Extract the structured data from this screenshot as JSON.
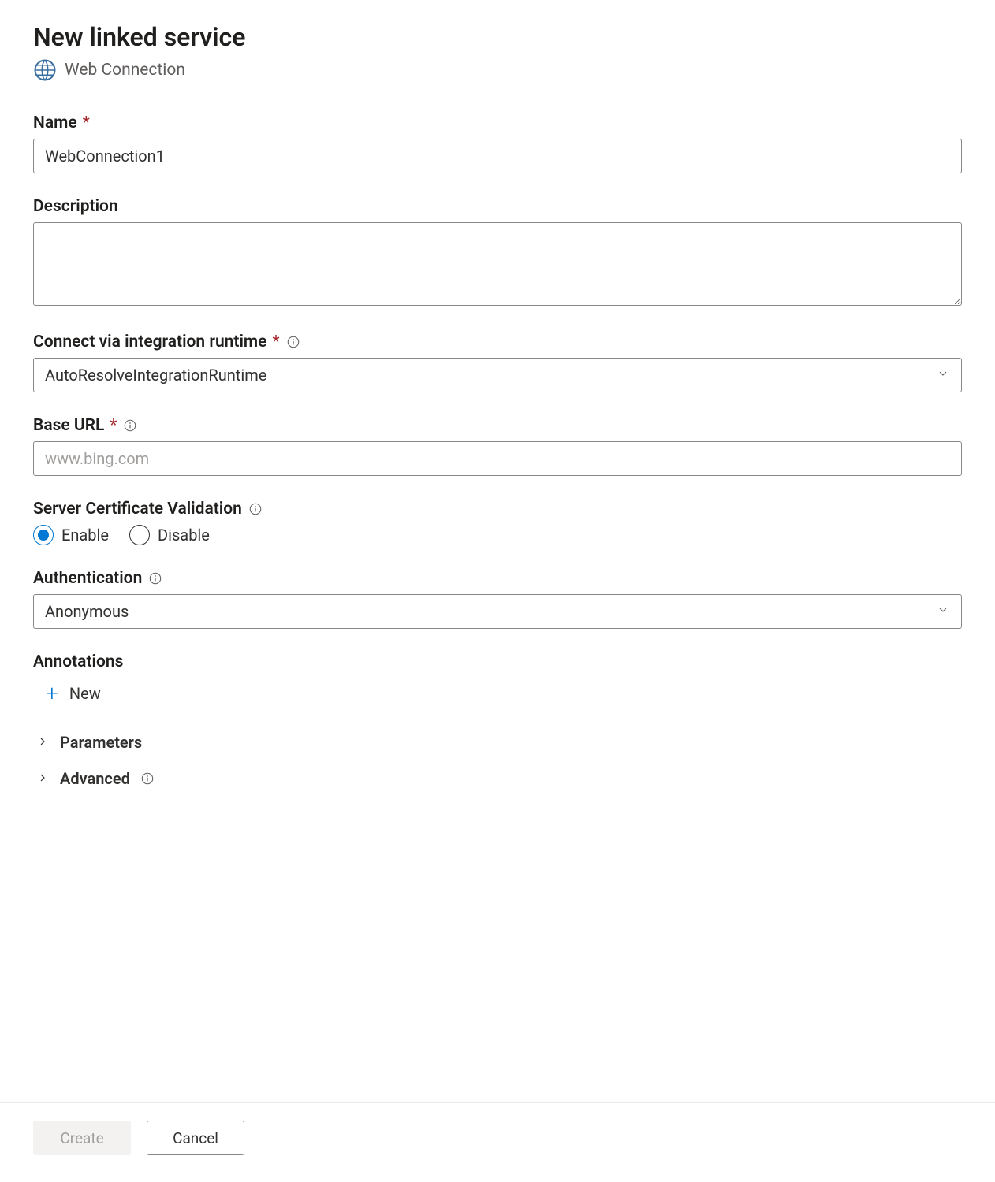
{
  "header": {
    "title": "New linked service",
    "subtitle": "Web Connection"
  },
  "form": {
    "name": {
      "label": "Name",
      "required": true,
      "value": "WebConnection1"
    },
    "description": {
      "label": "Description",
      "value": ""
    },
    "integration_runtime": {
      "label": "Connect via integration runtime",
      "required": true,
      "value": "AutoResolveIntegrationRuntime"
    },
    "base_url": {
      "label": "Base URL",
      "required": true,
      "placeholder": "www.bing.com",
      "value": ""
    },
    "server_cert": {
      "label": "Server Certificate Validation",
      "options": {
        "enable": "Enable",
        "disable": "Disable"
      },
      "selected": "enable"
    },
    "authentication": {
      "label": "Authentication",
      "value": "Anonymous"
    },
    "annotations": {
      "label": "Annotations",
      "new_label": "New"
    },
    "accordions": {
      "parameters": "Parameters",
      "advanced": "Advanced"
    }
  },
  "footer": {
    "create": "Create",
    "cancel": "Cancel"
  }
}
